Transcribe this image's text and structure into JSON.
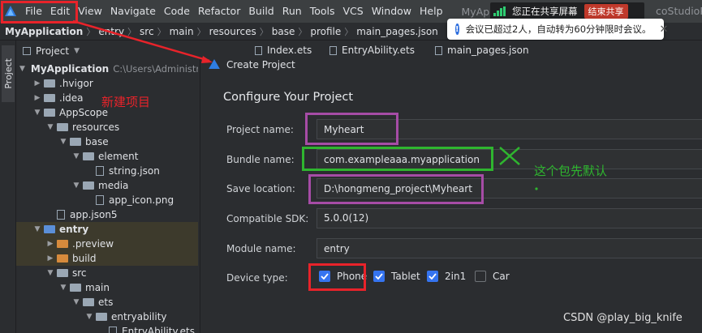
{
  "menubar": {
    "items": [
      "File",
      "Edit",
      "View",
      "Navigate",
      "Code",
      "Refactor",
      "Build",
      "Run",
      "Tools",
      "VCS",
      "Window",
      "Help"
    ],
    "window_title": "MyApplicatio",
    "path_fragment": "coStudioProjects\\"
  },
  "sharebar": {
    "text": "您正在共享屏幕",
    "stop_label": "结束共享"
  },
  "toast": {
    "text": "会议已超过2人，自动转为60分钟限时会议。"
  },
  "breadcrumb": [
    "MyApplication",
    "entry",
    "src",
    "main",
    "resources",
    "base",
    "profile",
    "main_pages.json"
  ],
  "toolstripe": {
    "project_tab": "Project"
  },
  "project_panel": {
    "title": "Project",
    "tree": [
      {
        "label": "MyApplication",
        "hint": "C:\\Users\\Administrat",
        "depth": 0,
        "kind": "module",
        "open": true,
        "bold": true
      },
      {
        "label": ".hvigor",
        "depth": 1,
        "kind": "folder",
        "open": false
      },
      {
        "label": ".idea",
        "depth": 1,
        "kind": "folder",
        "open": false
      },
      {
        "label": "AppScope",
        "depth": 1,
        "kind": "folder",
        "open": true
      },
      {
        "label": "resources",
        "depth": 2,
        "kind": "folder",
        "open": true
      },
      {
        "label": "base",
        "depth": 3,
        "kind": "folder",
        "open": true
      },
      {
        "label": "element",
        "depth": 4,
        "kind": "folder",
        "open": true
      },
      {
        "label": "string.json",
        "depth": 5,
        "kind": "file"
      },
      {
        "label": "media",
        "depth": 4,
        "kind": "folder",
        "open": true
      },
      {
        "label": "app_icon.png",
        "depth": 5,
        "kind": "file"
      },
      {
        "label": "app.json5",
        "depth": 2,
        "kind": "file"
      },
      {
        "label": "entry",
        "depth": 1,
        "kind": "module",
        "open": true,
        "bold": true,
        "highlight": true
      },
      {
        "label": ".preview",
        "depth": 2,
        "kind": "orange",
        "open": false,
        "highlight": true
      },
      {
        "label": "build",
        "depth": 2,
        "kind": "orange",
        "open": false,
        "highlight": true
      },
      {
        "label": "src",
        "depth": 2,
        "kind": "folder",
        "open": true
      },
      {
        "label": "main",
        "depth": 3,
        "kind": "folder",
        "open": true
      },
      {
        "label": "ets",
        "depth": 4,
        "kind": "folder",
        "open": true
      },
      {
        "label": "entryability",
        "depth": 5,
        "kind": "folder",
        "open": true
      },
      {
        "label": "EntryAbility.ets",
        "depth": 6,
        "kind": "file"
      }
    ]
  },
  "tabs": [
    "Index.ets",
    "EntryAbility.ets",
    "main_pages.json"
  ],
  "dialog": {
    "title": "Create Project",
    "heading": "Configure Your Project",
    "fields": {
      "project_name_label": "Project name:",
      "project_name_value": "Myheart",
      "bundle_name_label": "Bundle name:",
      "bundle_name_value": "com.exampleaaa.myapplication",
      "save_location_label": "Save location:",
      "save_location_value": "D:\\hongmeng_project\\Myheart",
      "sdk_label": "Compatible SDK:",
      "sdk_value": "5.0.0(12)",
      "module_name_label": "Module name:",
      "module_name_value": "entry",
      "device_type_label": "Device type:"
    },
    "device_types": [
      {
        "label": "Phone",
        "checked": true
      },
      {
        "label": "Tablet",
        "checked": true
      },
      {
        "label": "2in1",
        "checked": true
      },
      {
        "label": "Car",
        "checked": false
      }
    ]
  },
  "annotations": {
    "new_project": "新建项目",
    "bundle_note": "这个包先默认"
  },
  "watermark": "CSDN @play_big_knife",
  "colors": {
    "anno_red": "#e8232a",
    "anno_purple": "#a64ca6",
    "anno_green": "#2fb52f",
    "checkbox_blue": "#3574f0"
  }
}
